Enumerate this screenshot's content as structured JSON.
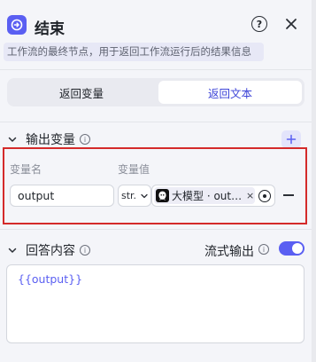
{
  "header": {
    "title": "结束",
    "icon": "end-node-icon",
    "accent": "#5a5ff2",
    "help": "?"
  },
  "description": "工作流的最终节点，用于返回工作流运行后的结果信息",
  "tabs": [
    {
      "label": "返回变量",
      "selected": false
    },
    {
      "label": "返回文本",
      "selected": true
    }
  ],
  "output_section": {
    "title": "输出变量",
    "col_name": "变量名",
    "col_value": "变量值",
    "variable": {
      "name": "output",
      "type": "str.",
      "ref_label": "大模型 · out…",
      "ref_icon": "llm-model-icon"
    }
  },
  "answer_section": {
    "title": "回答内容",
    "stream_label": "流式输出",
    "stream_enabled": true,
    "content": "{{output}}"
  },
  "colors": {
    "highlight_border": "#d42a2a",
    "selected_tab_text": "#3e45d8"
  }
}
